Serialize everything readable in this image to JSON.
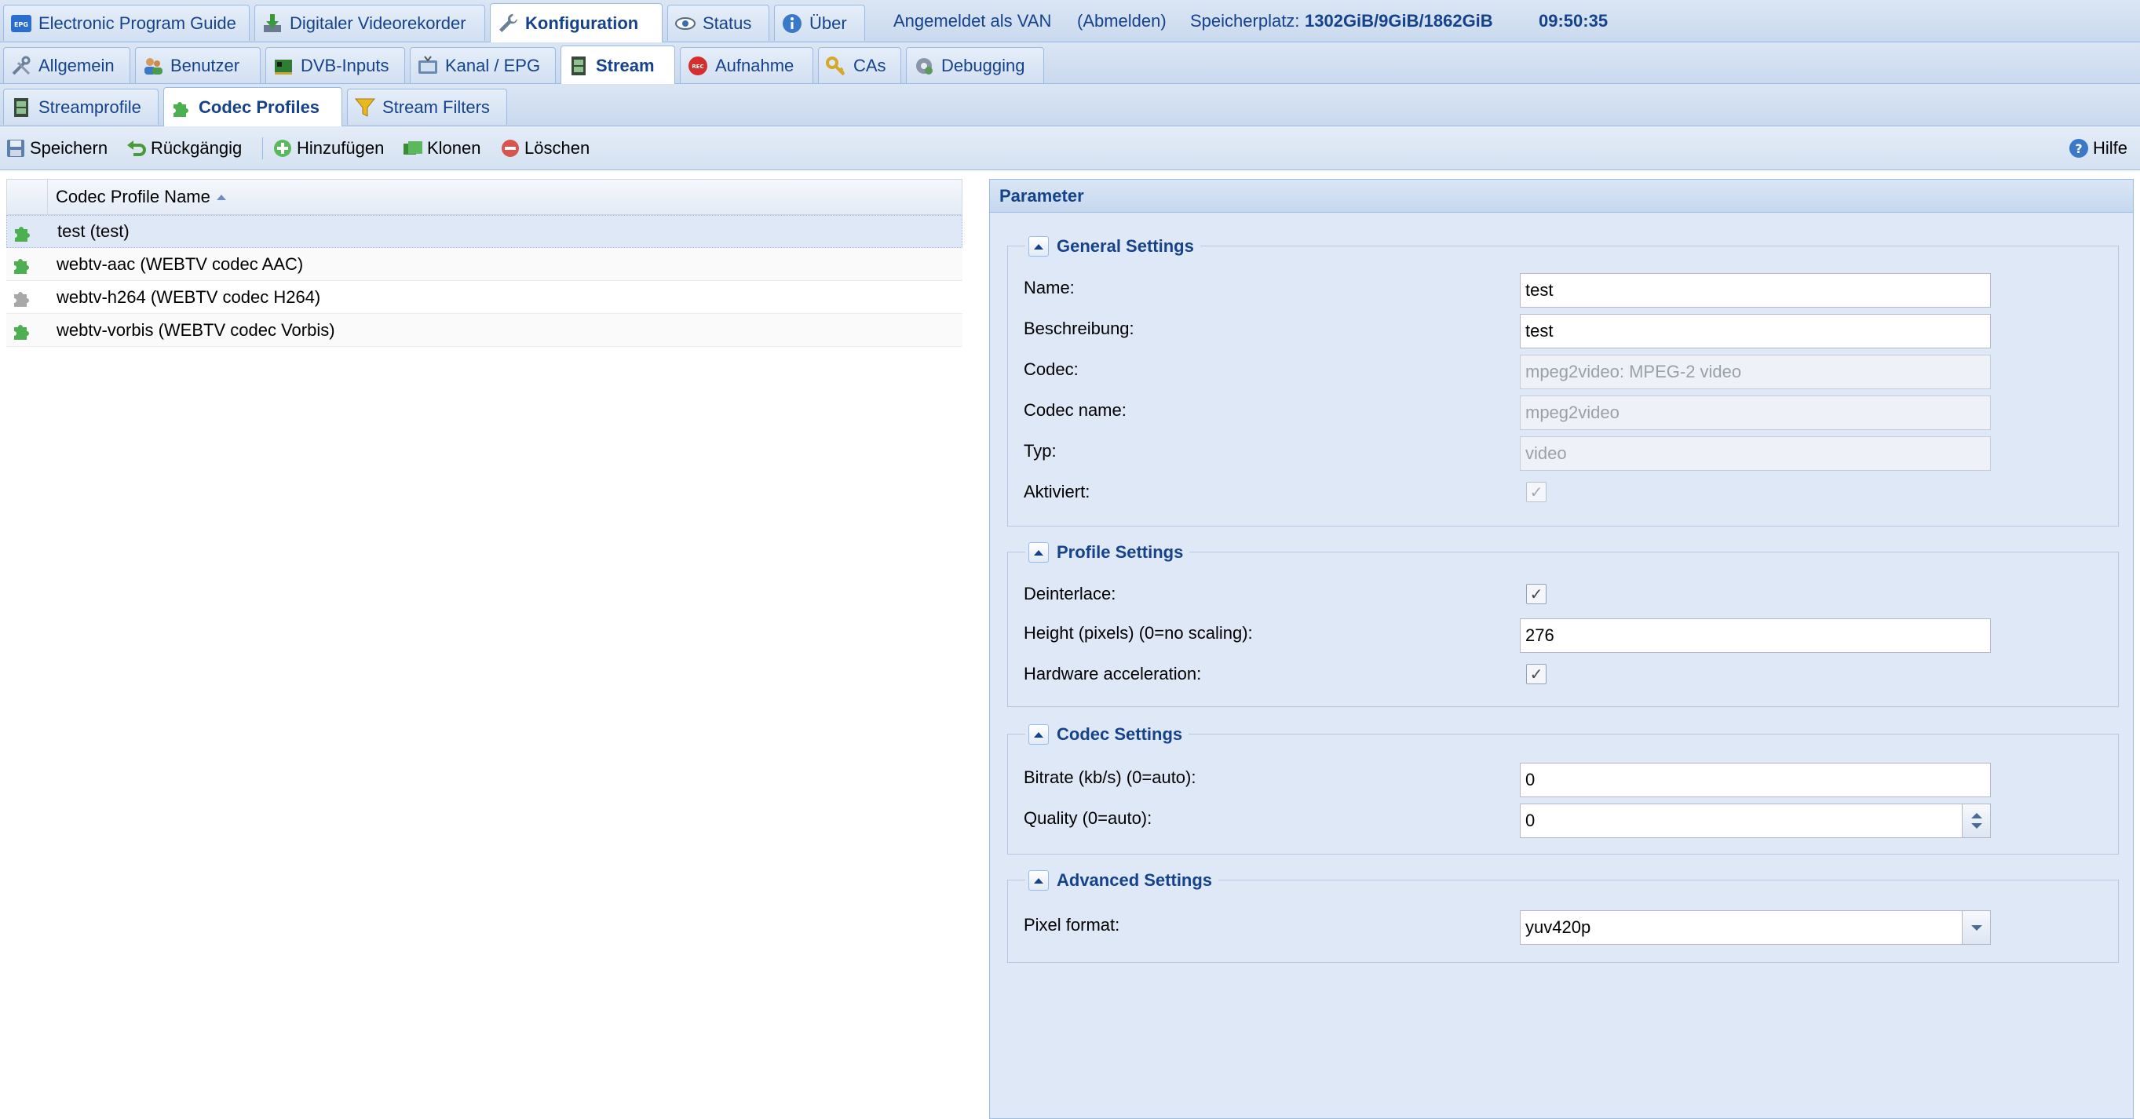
{
  "top_tabs": [
    {
      "label": "Electronic Program Guide",
      "icon": "epg-icon",
      "active": false
    },
    {
      "label": "Digitaler Videorekorder",
      "icon": "dvr-download-icon",
      "active": false
    },
    {
      "label": "Konfiguration",
      "icon": "wrench-icon",
      "active": true
    },
    {
      "label": "Status",
      "icon": "eye-icon",
      "active": false
    },
    {
      "label": "Über",
      "icon": "info-icon",
      "active": false
    }
  ],
  "session": {
    "logged_in": "Angemeldet als VAN",
    "logout": "(Abmelden)",
    "storage_label": "Speicherplatz:",
    "storage_value": "1302GiB/9GiB/1862GiB",
    "time": "09:50:35"
  },
  "config_tabs": [
    {
      "label": "Allgemein",
      "icon": "tools-icon",
      "active": false
    },
    {
      "label": "Benutzer",
      "icon": "users-icon",
      "active": false
    },
    {
      "label": "DVB-Inputs",
      "icon": "dvb-card-icon",
      "active": false
    },
    {
      "label": "Kanal / EPG",
      "icon": "tv-icon",
      "active": false
    },
    {
      "label": "Stream",
      "icon": "film-icon",
      "active": true
    },
    {
      "label": "Aufnahme",
      "icon": "rec-icon",
      "active": false
    },
    {
      "label": "CAs",
      "icon": "key-icon",
      "active": false
    },
    {
      "label": "Debugging",
      "icon": "bug-gear-icon",
      "active": false
    }
  ],
  "stream_tabs": [
    {
      "label": "Streamprofile",
      "icon": "film-icon",
      "active": false
    },
    {
      "label": "Codec Profiles",
      "icon": "puzzle-icon",
      "active": true
    },
    {
      "label": "Stream Filters",
      "icon": "funnel-icon",
      "active": false
    }
  ],
  "toolbar": {
    "save": "Speichern",
    "undo": "Rückgängig",
    "add": "Hinzufügen",
    "clone": "Klonen",
    "delete": "Löschen",
    "help": "Hilfe"
  },
  "grid": {
    "column": "Codec Profile Name",
    "rows": [
      {
        "name": "test (test)",
        "enabled": true,
        "selected": true
      },
      {
        "name": "webtv-aac (WEBTV codec AAC)",
        "enabled": true,
        "selected": false
      },
      {
        "name": "webtv-h264 (WEBTV codec H264)",
        "enabled": false,
        "selected": false
      },
      {
        "name": "webtv-vorbis (WEBTV codec Vorbis)",
        "enabled": true,
        "selected": false
      }
    ]
  },
  "panel": {
    "title": "Parameter",
    "general": {
      "legend": "General Settings",
      "name_label": "Name:",
      "name_value": "test",
      "desc_label": "Beschreibung:",
      "desc_value": "test",
      "codec_label": "Codec:",
      "codec_value": "mpeg2video: MPEG-2 video",
      "codec_name_label": "Codec name:",
      "codec_name_value": "mpeg2video",
      "type_label": "Typ:",
      "type_value": "video",
      "enabled_label": "Aktiviert:",
      "enabled_checked": true
    },
    "profile": {
      "legend": "Profile Settings",
      "deinterlace_label": "Deinterlace:",
      "deinterlace_checked": true,
      "height_label": "Height (pixels) (0=no scaling):",
      "height_value": "276",
      "hwaccel_label": "Hardware acceleration:",
      "hwaccel_checked": true
    },
    "codec": {
      "legend": "Codec Settings",
      "bitrate_label": "Bitrate (kb/s) (0=auto):",
      "bitrate_value": "0",
      "quality_label": "Quality (0=auto):",
      "quality_value": "0"
    },
    "advanced": {
      "legend": "Advanced Settings",
      "pixfmt_label": "Pixel format:",
      "pixfmt_value": "yuv420p"
    }
  },
  "colors": {
    "accent": "#15428b",
    "tabbar": "#c9d9ee",
    "panel_bg": "#dfe8f6",
    "border": "#99bbe8"
  }
}
